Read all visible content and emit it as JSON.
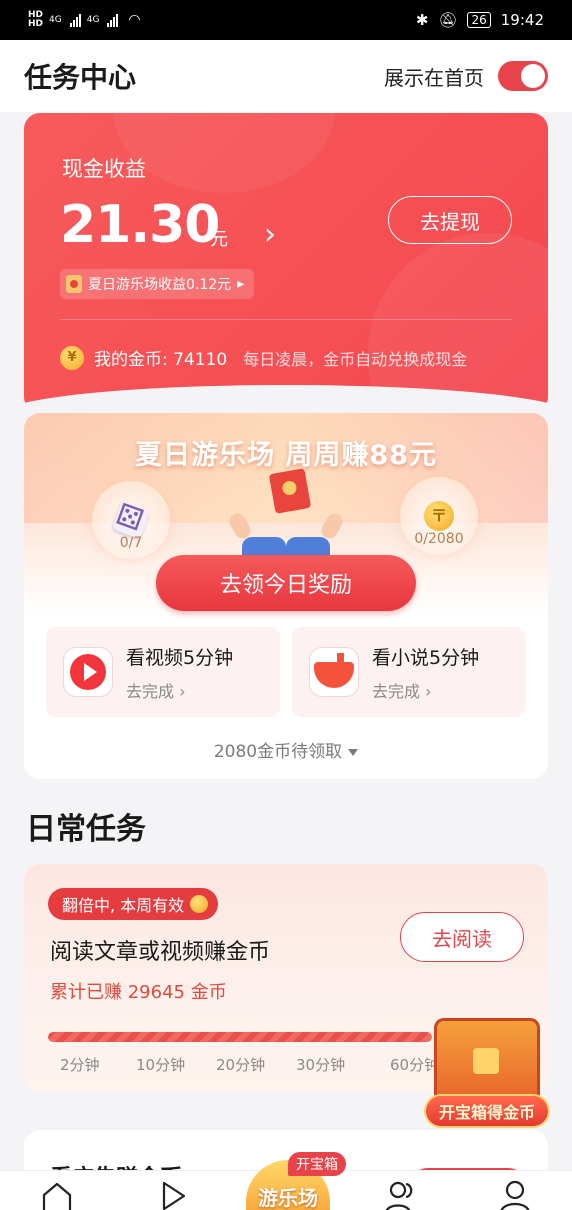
{
  "status_bar": {
    "left_labels": [
      "HD",
      "HD",
      "4G",
      "4G"
    ],
    "battery": "26",
    "time": "19:42"
  },
  "header": {
    "title": "任务中心",
    "show_on_home_label": "展示在首页",
    "show_on_home_enabled": true,
    "toggle_color": "#e8424a"
  },
  "earnings": {
    "label": "现金收益",
    "amount": "21.30",
    "unit": "元",
    "arrow": "›",
    "withdraw_label": "去提现",
    "summer_income": "夏日游乐场收益0.12元",
    "chip_arrow": "▸",
    "coins_label": "我的金币: 74110",
    "coins_hint": "每日凌晨，金币自动兑换成现金",
    "card_color": "#f4474f"
  },
  "summer": {
    "title": "夏日游乐场 周周赚88元",
    "left_count": "0/7",
    "right_count": "0/2080",
    "coin_symbol": "〒",
    "claim_label": "去领今日奖励",
    "tasks": [
      {
        "icon": "video-app-icon",
        "title": "看视频5分钟",
        "sub": "去完成 ›"
      },
      {
        "icon": "novel-app-icon",
        "title": "看小说5分钟",
        "sub": "去完成 ›"
      }
    ],
    "pending": "2080金币待领取"
  },
  "daily": {
    "section_title": "日常任务",
    "badge": "翻倍中, 本周有效",
    "title": "阅读文章或视频赚金币",
    "total": "累计已赚 29645 金币",
    "read_label": "去阅读",
    "progress_fraction": 1.0,
    "ticks": [
      "2分钟",
      "10分钟",
      "20分钟",
      "30分钟",
      "60分钟"
    ]
  },
  "chest": {
    "label": "开宝箱得金币"
  },
  "next_card": {
    "title_partial": "看广告赚金币"
  },
  "tab_bar": {
    "center_label": "游乐场",
    "open_tag": "开宝箱",
    "icons": [
      "home-icon",
      "video-play-icon",
      "friends-icon",
      "profile-icon"
    ]
  }
}
